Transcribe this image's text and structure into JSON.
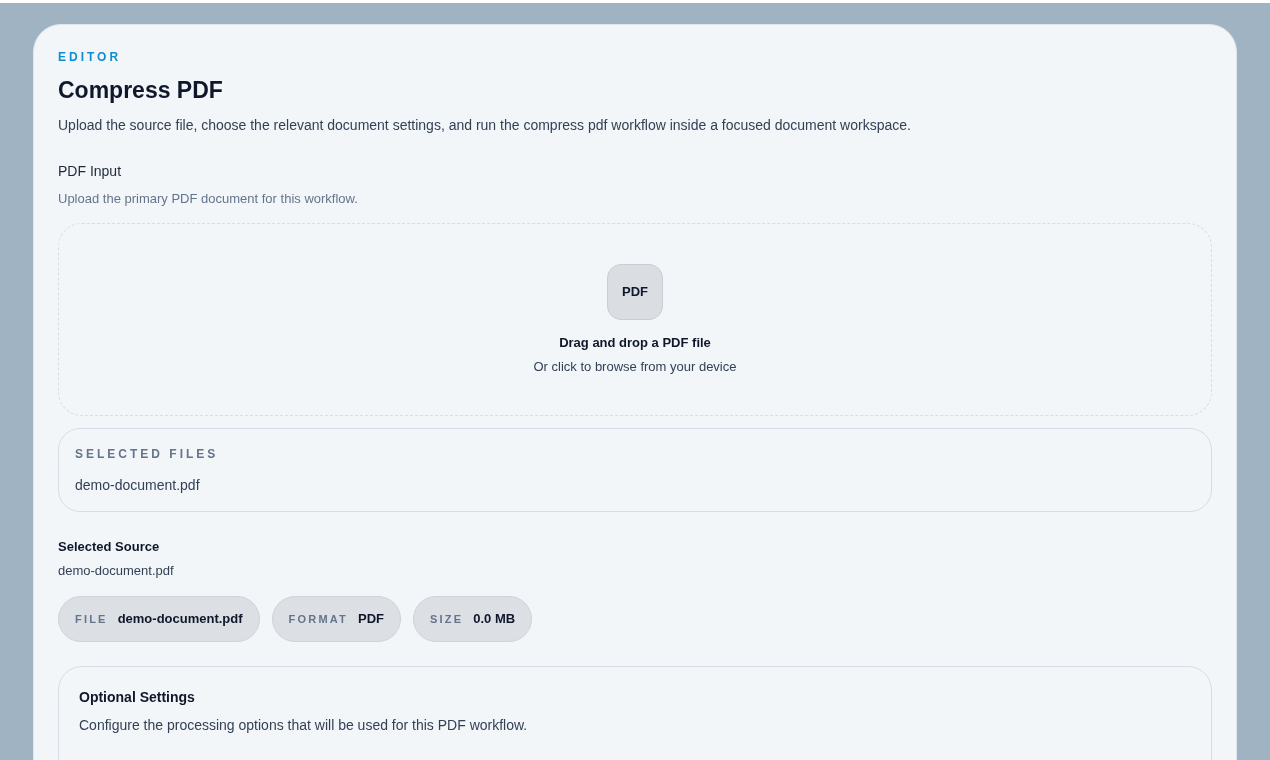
{
  "header": {
    "eyebrow": "EDITOR",
    "title": "Compress PDF",
    "description": "Upload the source file, choose the relevant document settings, and run the compress pdf workflow inside a focused document workspace."
  },
  "input": {
    "label": "PDF Input",
    "hint": "Upload the primary PDF document for this workflow.",
    "dropzone": {
      "badge": "PDF",
      "title": "Drag and drop a PDF file",
      "subtitle": "Or click to browse from your device"
    }
  },
  "selected_files": {
    "heading": "SELECTED FILES",
    "files": [
      "demo-document.pdf"
    ]
  },
  "selected_source": {
    "heading": "Selected Source",
    "name": "demo-document.pdf",
    "chips": [
      {
        "key": "FILE",
        "value": "demo-document.pdf"
      },
      {
        "key": "FORMAT",
        "value": "PDF"
      },
      {
        "key": "SIZE",
        "value": "0.0 MB"
      }
    ]
  },
  "optional_settings": {
    "title": "Optional Settings",
    "description": "Configure the processing options that will be used for this PDF workflow."
  }
}
